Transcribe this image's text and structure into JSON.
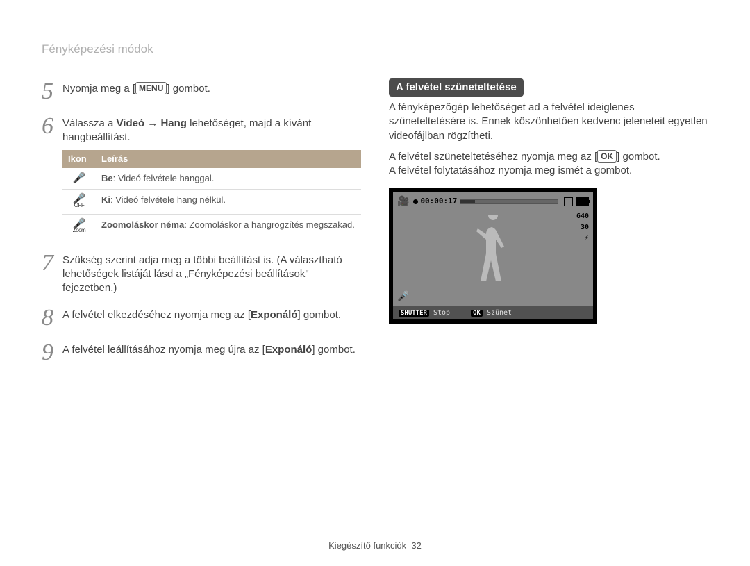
{
  "section_title": "Fényképezési módok",
  "left": {
    "steps": {
      "s5": {
        "num": "5",
        "pre": "Nyomja meg a [",
        "btn": "MENU",
        "post": "] gombot."
      },
      "s6": {
        "num": "6",
        "pre": "Válassza a ",
        "b1": "Videó",
        "arrow": " → ",
        "b2": "Hang",
        "post": " lehetőséget, majd a kívánt hangbeállítást."
      },
      "s7": {
        "num": "7",
        "text": "Szükség szerint adja meg a többi beállítást is. (A választható lehetőségek listáját lásd a „Fényképezési beállítások\" fejezetben.)"
      },
      "s8": {
        "num": "8",
        "pre": "A felvétel elkezdéséhez nyomja meg az [",
        "b": "Exponáló",
        "post": "] gombot."
      },
      "s9": {
        "num": "9",
        "pre": "A felvétel leállításához nyomja meg újra az [",
        "b": "Exponáló",
        "post": "] gombot."
      }
    },
    "table": {
      "headers": {
        "c1": "Ikon",
        "c2": "Leírás"
      },
      "rows": [
        {
          "icon_name": "mic-on-icon",
          "k": "Be",
          "v": ": Videó felvétele hanggal."
        },
        {
          "icon_name": "mic-off-icon",
          "sub": "OFF",
          "k": "Ki",
          "v": ": Videó felvétele hang nélkül."
        },
        {
          "icon_name": "mic-zoom-icon",
          "sub": "Zoom",
          "k": "Zoomoláskor néma",
          "v": ": Zoomoláskor a hangrögzítés megszakad."
        }
      ]
    }
  },
  "right": {
    "heading": "A felvétel szüneteltetése",
    "p1": "A fényképezőgép lehetőséget ad a felvétel ideiglenes szüneteltetésére is. Ennek köszönhetően kedvenc jeleneteit egyetlen videofájlban rögzítheti.",
    "p2_pre": "A felvétel szüneteltetéséhez nyomja meg az [",
    "p2_btn": "OK",
    "p2_post": "] gombot.",
    "p3": "A felvétel folytatásához nyomja meg ismét a gombot.",
    "lcd": {
      "time": "00:00:17",
      "res": "640",
      "fps": "30",
      "flash": "⚡",
      "stop_key": "SHUTTER",
      "stop_label": "Stop",
      "pause_key": "OK",
      "pause_label": "Szünet"
    }
  },
  "footer": {
    "section": "Kiegészítő funkciók",
    "page": "32"
  }
}
